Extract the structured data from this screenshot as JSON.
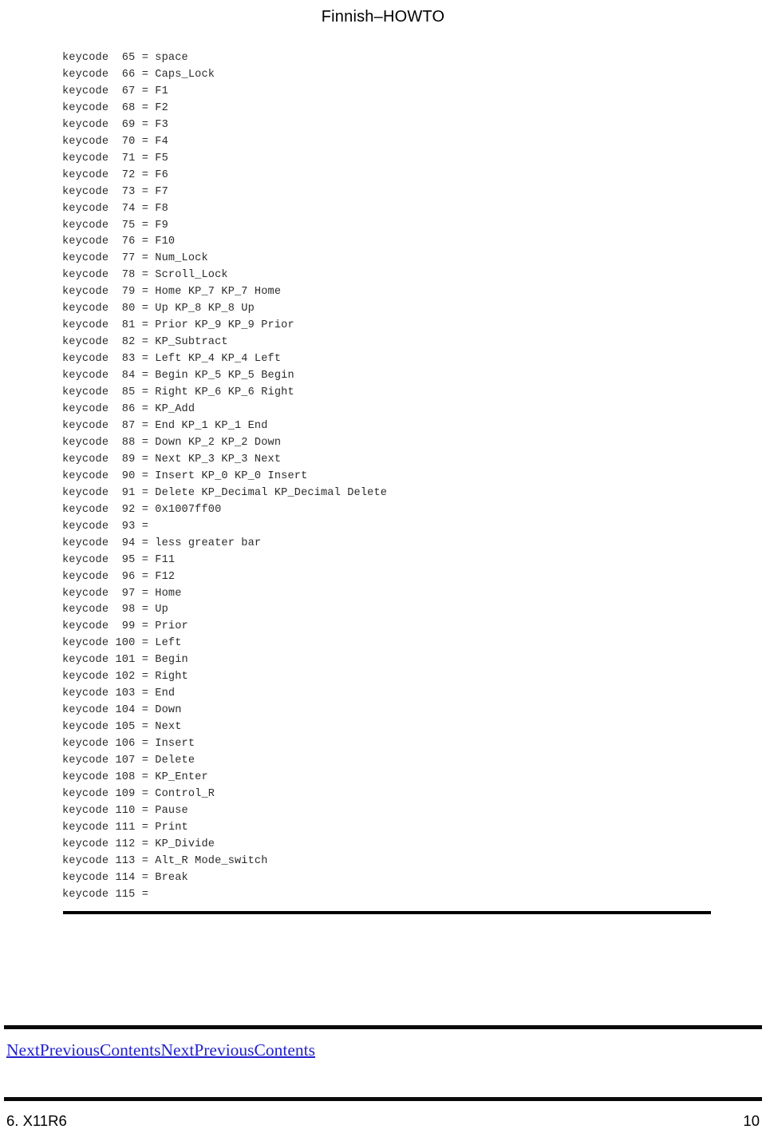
{
  "header": {
    "running_title": "Finnish–HOWTO"
  },
  "code_block": {
    "lines": [
      "keycode  65 = space",
      "keycode  66 = Caps_Lock",
      "keycode  67 = F1",
      "keycode  68 = F2",
      "keycode  69 = F3",
      "keycode  70 = F4",
      "keycode  71 = F5",
      "keycode  72 = F6",
      "keycode  73 = F7",
      "keycode  74 = F8",
      "keycode  75 = F9",
      "keycode  76 = F10",
      "keycode  77 = Num_Lock",
      "keycode  78 = Scroll_Lock",
      "keycode  79 = Home KP_7 KP_7 Home",
      "keycode  80 = Up KP_8 KP_8 Up",
      "keycode  81 = Prior KP_9 KP_9 Prior",
      "keycode  82 = KP_Subtract",
      "keycode  83 = Left KP_4 KP_4 Left",
      "keycode  84 = Begin KP_5 KP_5 Begin",
      "keycode  85 = Right KP_6 KP_6 Right",
      "keycode  86 = KP_Add",
      "keycode  87 = End KP_1 KP_1 End",
      "keycode  88 = Down KP_2 KP_2 Down",
      "keycode  89 = Next KP_3 KP_3 Next",
      "keycode  90 = Insert KP_0 KP_0 Insert",
      "keycode  91 = Delete KP_Decimal KP_Decimal Delete",
      "keycode  92 = 0x1007ff00",
      "keycode  93 =",
      "keycode  94 = less greater bar",
      "keycode  95 = F11",
      "keycode  96 = F12",
      "keycode  97 = Home",
      "keycode  98 = Up",
      "keycode  99 = Prior",
      "keycode 100 = Left",
      "keycode 101 = Begin",
      "keycode 102 = Right",
      "keycode 103 = End",
      "keycode 104 = Down",
      "keycode 105 = Next",
      "keycode 106 = Insert",
      "keycode 107 = Delete",
      "keycode 108 = KP_Enter",
      "keycode 109 = Control_R",
      "keycode 110 = Pause",
      "keycode 111 = Print",
      "keycode 112 = KP_Divide",
      "keycode 113 = Alt_R Mode_switch",
      "keycode 114 = Break",
      "keycode 115 ="
    ]
  },
  "navigation": {
    "links": [
      {
        "label": "Next"
      },
      {
        "label": "Previous"
      },
      {
        "label": "Contents"
      },
      {
        "label": "Next"
      },
      {
        "label": "Previous"
      },
      {
        "label": "Contents"
      }
    ]
  },
  "footer": {
    "section": "6. X11R6",
    "page_number": "10"
  },
  "colors": {
    "link": "#2222cc",
    "code_text": "#2b2b2b",
    "rule": "#0a0a0a",
    "background": "#ffffff"
  }
}
